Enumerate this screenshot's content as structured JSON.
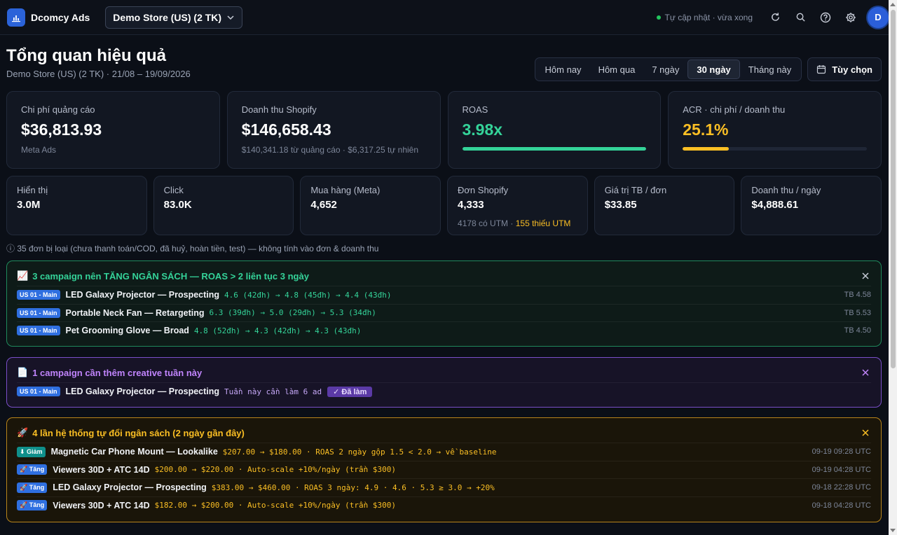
{
  "app": {
    "name": "Dcomcy Ads",
    "accent": "#2b63d9"
  },
  "header": {
    "store_select": "Demo Store (US) (2 TK)",
    "status": "Tự cập nhật · vừa xong",
    "avatar_letter": "D"
  },
  "page": {
    "title": "Tổng quan hiệu quả",
    "subtitle": "Demo Store (US) (2 TK) · 21/08 – 19/09/2026"
  },
  "ranges": {
    "items": [
      "Hôm nay",
      "Hôm qua",
      "7 ngày",
      "30 ngày",
      "Tháng này"
    ],
    "active": "30 ngày",
    "custom_label": "Tùy chọn"
  },
  "kpis": [
    {
      "label": "Chi phí quảng cáo",
      "value": "$36,813.93",
      "note": "Meta Ads"
    },
    {
      "label": "Doanh thu Shopify",
      "value": "$146,658.43",
      "note": "$140,341.18 từ quảng cáo · $6,317.25 tự nhiên"
    },
    {
      "label": "ROAS",
      "value": "3.98x",
      "progress": 1.0,
      "color": "#34d399"
    },
    {
      "label": "ACR · chi phí / doanh thu",
      "value": "25.1%",
      "progress": 0.251,
      "color": "#fbbf24"
    }
  ],
  "stats": [
    {
      "label": "Hiển thị",
      "value": "3.0M"
    },
    {
      "label": "Click",
      "value": "83.0K"
    },
    {
      "label": "Mua hàng (Meta)",
      "value": "4,652"
    },
    {
      "label": "Đơn Shopify",
      "value": "4,333",
      "note": "4178 có UTM · ",
      "note_warn": "155 thiếu UTM"
    },
    {
      "label": "Giá trị TB / đơn",
      "value": "$33.85"
    },
    {
      "label": "Doanh thu / ngày",
      "value": "$4,888.61"
    }
  ],
  "excluded_note": "ⓘ 35 đơn bị loại (chưa thanh toán/COD, đã huỷ, hoàn tiền, test) — không tính vào đơn & doanh thu",
  "alerts": {
    "budget_up": {
      "icon": "📈",
      "title": "3 campaign nên TĂNG NGÂN SÁCH — ROAS > 2 liên tục 3 ngày",
      "rows": [
        {
          "tag": "US 01 - Main",
          "name": "LED Galaxy Projector — Prospecting",
          "detail": "4.6 (42đh) → 4.8 (45đh) → 4.4 (43đh)",
          "right": "TB 4.58"
        },
        {
          "tag": "US 01 - Main",
          "name": "Portable Neck Fan — Retargeting",
          "detail": "6.3 (39đh) → 5.0 (29đh) → 5.3 (34đh)",
          "right": "TB 5.53"
        },
        {
          "tag": "US 01 - Main",
          "name": "Pet Grooming Glove — Broad",
          "detail": "4.8 (52đh) → 4.3 (42đh) → 4.3 (43đh)",
          "right": "TB 4.50"
        }
      ]
    },
    "creative": {
      "icon": "📄",
      "title": "1 campaign cần thêm creative tuần này",
      "rows": [
        {
          "tag": "US 01 - Main",
          "name": "LED Galaxy Projector — Prospecting",
          "detail": "Tuần này cần làm 6 ad",
          "badge": "✓ Đã làm"
        }
      ]
    },
    "auto_budget": {
      "icon": "🚀",
      "title": "4 lần hệ thống tự đổi ngân sách (2 ngày gần đây)",
      "rows": [
        {
          "tag": "⬇ Giảm",
          "name": "Magnetic Car Phone Mount — Lookalike",
          "detail": "$207.00 → $180.00 · ROAS 2 ngày gộp 1.5 < 2.0 → về baseline",
          "right": "09-19 09:28 UTC"
        },
        {
          "tag": "🚀 Tăng",
          "name": "Viewers 30D + ATC 14D",
          "detail": "$200.00 → $220.00 · Auto-scale +10%/ngày (trần $300)",
          "right": "09-19 04:28 UTC"
        },
        {
          "tag": "🚀 Tăng",
          "name": "LED Galaxy Projector — Prospecting",
          "detail": "$383.00 → $460.00 · ROAS 3 ngày: 4.9 · 4.6 · 5.3 ≥ 3.0 → +20%",
          "right": "09-18 22:28 UTC"
        },
        {
          "tag": "🚀 Tăng",
          "name": "Viewers 30D + ATC 14D",
          "detail": "$182.00 → $200.00 · Auto-scale +10%/ngày (trần $300)",
          "right": "09-18 04:28 UTC"
        }
      ]
    }
  }
}
